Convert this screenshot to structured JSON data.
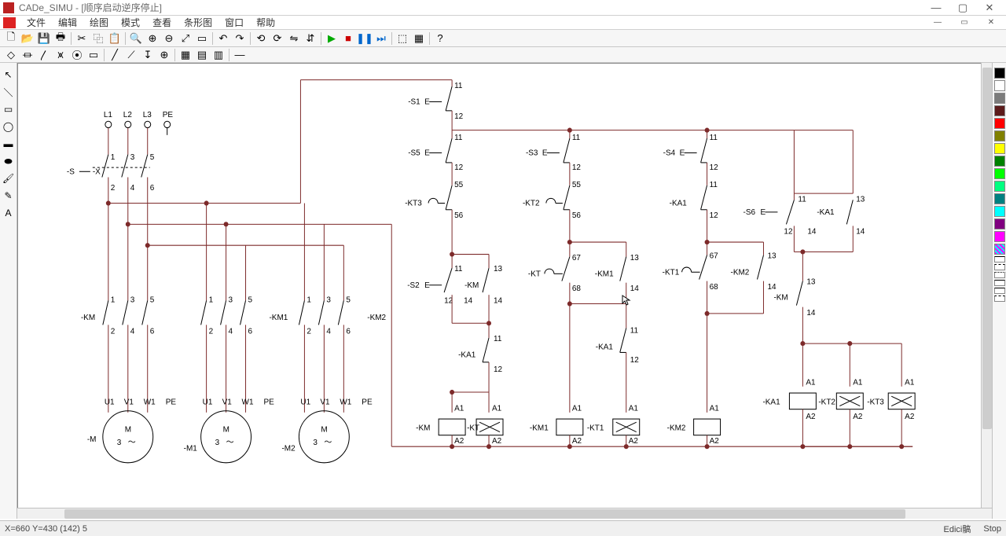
{
  "title": "CADe_SIMU - [顺序启动逆序停止]",
  "menu": [
    "文件",
    "编辑",
    "绘图",
    "模式",
    "查看",
    "条形图",
    "窗口",
    "帮助"
  ],
  "status": {
    "coords": "X=660  Y=430 (142) 5",
    "mode": "Edici髇",
    "action": "Stop"
  },
  "palette_colors": [
    "#000000",
    "#ffffff",
    "#7b7b7b",
    "#5c1b1b",
    "#ff0000",
    "#808000",
    "#ffff00",
    "#008000",
    "#00ff00",
    "#00ff80",
    "#008080",
    "#00ffff",
    "#800080",
    "#ff00ff"
  ],
  "right_dashes": 6,
  "labels": {
    "X": "-X",
    "L1": "L1",
    "L2": "L2",
    "L3": "L3",
    "PE": "PE",
    "S": "-S",
    "KM": "-KM",
    "KM1": "-KM1",
    "KM2": "-KM2",
    "M": "-M",
    "M1": "-M1",
    "M2": "-M2",
    "mletter": "M",
    "m3": "3",
    "U1": "U1",
    "V1": "V1",
    "W1": "W1",
    "S1": "-S1",
    "S2": "-S2",
    "S3": "-S3",
    "S4": "-S4",
    "S5": "-S5",
    "S6": "-S6",
    "E": "E",
    "KT": "-KT",
    "KT1": "-KT1",
    "KT2": "-KT2",
    "KT3": "-KT3",
    "KA1": "-KA1",
    "num1": "1",
    "num2": "2",
    "num3": "3",
    "num4": "4",
    "num5": "5",
    "num6": "6",
    "t11": "11",
    "t12": "12",
    "t13": "13",
    "t14": "14",
    "t55": "55",
    "t56": "56",
    "t67": "67",
    "t68": "68",
    "A1": "A1",
    "A2": "A2"
  },
  "chart_data": {
    "type": "electrical_schematic",
    "title": "顺序启动逆序停止 (Sequential start / reverse stop)",
    "supply_terminals": {
      "ref": "-X",
      "lines": [
        "L1",
        "L2",
        "L3",
        "PE"
      ]
    },
    "power_circuit": {
      "disconnect_switch": {
        "ref": "-S",
        "poles": 3,
        "terminals_in": [
          1,
          3,
          5
        ],
        "terminals_out": [
          2,
          4,
          6
        ]
      },
      "contactors_main": [
        {
          "ref": "-KM",
          "poles": 3,
          "in": [
            1,
            3,
            5
          ],
          "out": [
            2,
            4,
            6
          ],
          "feeds_motor": "-M"
        },
        {
          "ref": "-KM1",
          "poles": 3,
          "in": [
            1,
            3,
            5
          ],
          "out": [
            2,
            4,
            6
          ],
          "feeds_motor": "-M1"
        },
        {
          "ref": "-KM2",
          "poles": 3,
          "in": [
            1,
            3,
            5
          ],
          "out": [
            2,
            4,
            6
          ],
          "feeds_motor": "-M2"
        }
      ],
      "motors": [
        {
          "ref": "-M",
          "terminals": [
            "U1",
            "V1",
            "W1",
            "PE"
          ],
          "type": "3~ M"
        },
        {
          "ref": "-M1",
          "terminals": [
            "U1",
            "V1",
            "W1",
            "PE"
          ],
          "type": "3~ M"
        },
        {
          "ref": "-M2",
          "terminals": [
            "U1",
            "V1",
            "W1",
            "PE"
          ],
          "type": "3~ M"
        }
      ]
    },
    "control_circuit": {
      "common_stop": {
        "ref": "-S1",
        "type": "NC pushbutton",
        "terminals": [
          11,
          12
        ]
      },
      "branches": [
        {
          "start_button": {
            "ref": "-S2",
            "type": "NO pushbutton",
            "terminals": [
              13,
              14
            ]
          },
          "branch_stop": {
            "ref": "-S5",
            "type": "NC pushbutton",
            "terminals": [
              11,
              12
            ]
          },
          "timer_contact": {
            "ref": "-KT3",
            "type": "NC timed",
            "terminals": [
              55,
              56
            ]
          },
          "hold_contact": {
            "ref": "-KM",
            "type": "NO aux",
            "terminals": [
              13,
              14
            ]
          },
          "coil_interlock": {
            "ref": "-KA1",
            "type": "NC aux",
            "terminals": [
              11,
              12
            ]
          },
          "coils": [
            {
              "ref": "-KM",
              "terminals": [
                "A1",
                "A2"
              ]
            },
            {
              "ref": "-KT",
              "terminals": [
                "A1",
                "A2"
              ]
            }
          ]
        },
        {
          "branch_stop": {
            "ref": "-S3",
            "type": "NC pushbutton",
            "terminals": [
              11,
              12
            ]
          },
          "timer_enable": {
            "ref": "-KT",
            "type": "NO timed",
            "terminals": [
              67,
              68
            ]
          },
          "timer_contact": {
            "ref": "-KT2",
            "type": "NC timed",
            "terminals": [
              55,
              56
            ]
          },
          "hold_contact": {
            "ref": "-KM1",
            "type": "NO aux",
            "terminals": [
              13,
              14
            ]
          },
          "coil_interlock": {
            "ref": "-KA1",
            "type": "NC aux",
            "terminals": [
              11,
              12
            ]
          },
          "coils": [
            {
              "ref": "-KM1",
              "terminals": [
                "A1",
                "A2"
              ]
            },
            {
              "ref": "-KT1",
              "terminals": [
                "A1",
                "A2"
              ]
            }
          ]
        },
        {
          "branch_stop": {
            "ref": "-S4",
            "type": "NC pushbutton",
            "terminals": [
              11,
              12
            ]
          },
          "timer_enable": {
            "ref": "-KT1",
            "type": "NO timed",
            "terminals": [
              67,
              68
            ]
          },
          "interlock": {
            "ref": "-KA1",
            "type": "NC aux",
            "terminals": [
              11,
              12
            ]
          },
          "hold_contact": {
            "ref": "-KM2",
            "type": "NO aux",
            "terminals": [
              13,
              14
            ]
          },
          "coils": [
            {
              "ref": "-KM2",
              "terminals": [
                "A1",
                "A2"
              ]
            }
          ]
        },
        {
          "stop_branch": true,
          "stop_button": {
            "ref": "-S6",
            "type": "NO pushbutton",
            "terminals": [
              13,
              14
            ]
          },
          "self_hold": {
            "ref": "-KA1",
            "type": "NO aux",
            "terminals": [
              13,
              14
            ]
          },
          "enable": {
            "ref": "-KM",
            "type": "NO aux",
            "terminals": [
              13,
              14
            ]
          },
          "coils": [
            {
              "ref": "-KA1",
              "terminals": [
                "A1",
                "A2"
              ]
            },
            {
              "ref": "-KT2",
              "terminals": [
                "A1",
                "A2"
              ]
            },
            {
              "ref": "-KT3",
              "terminals": [
                "A1",
                "A2"
              ]
            }
          ]
        }
      ]
    }
  }
}
